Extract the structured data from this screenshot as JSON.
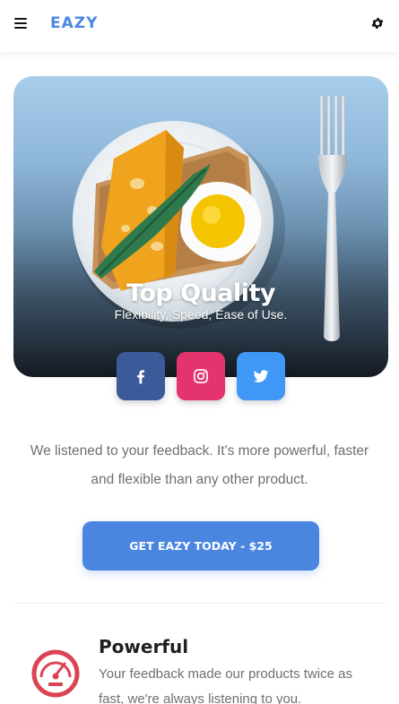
{
  "header": {
    "brand": "EAZY",
    "menu_icon": "hamburger-menu-icon",
    "settings_icon": "gear-icon",
    "brand_color": "#4a86e0"
  },
  "hero": {
    "title": "Top Quality",
    "subtitle": "Flexibility, Speed, Ease of Use."
  },
  "social": [
    {
      "name": "facebook",
      "icon": "facebook-icon",
      "color": "#3b5a9a"
    },
    {
      "name": "instagram",
      "icon": "instagram-icon",
      "color": "#e3346d"
    },
    {
      "name": "twitter",
      "icon": "twitter-icon",
      "color": "#3f97f6"
    }
  ],
  "intro": {
    "text": "We listened to your feedback. It's more powerful, faster and flexible than any other product."
  },
  "cta": {
    "label": "GET EAZY TODAY - $25"
  },
  "features": [
    {
      "icon": "speedometer-icon",
      "title": "Powerful",
      "text": "Your feedback made our products twice as fast, we're always listening to you.",
      "icon_color": "#da4453"
    }
  ]
}
